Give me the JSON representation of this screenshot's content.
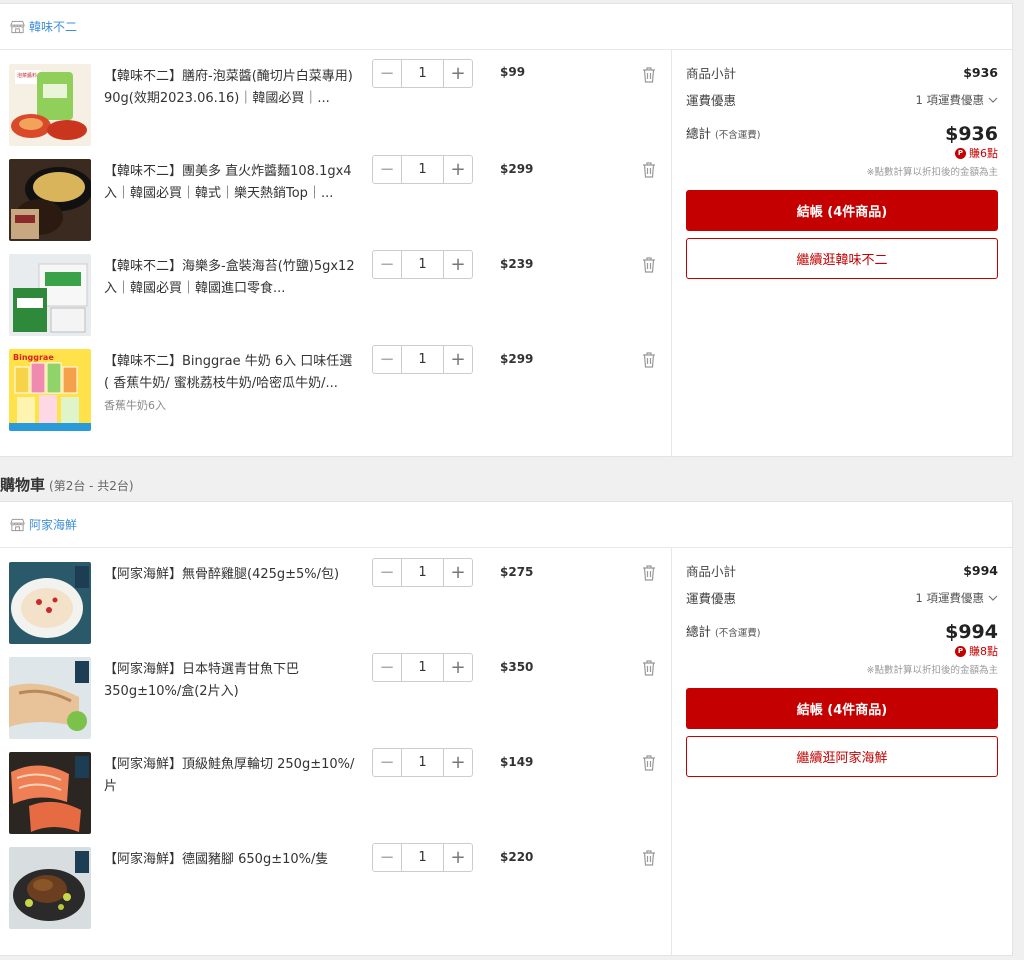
{
  "carts": [
    {
      "store": "韓味不二",
      "items": [
        {
          "name": "【韓味不二】膳府-泡菜醬(醃切片白菜專用) 90g(效期2023.06.16)｜韓國必買｜...",
          "spec": "",
          "qty": "1",
          "price": "$99",
          "image": "kimchi-sauce-image"
        },
        {
          "name": "【韓味不二】團美多 直火炸醬麵108.1gx4入｜韓國必買｜韓式｜樂天熱銷Top｜...",
          "spec": "",
          "qty": "1",
          "price": "$299",
          "image": "black-bean-noodle-image"
        },
        {
          "name": "【韓味不二】海樂多-盒裝海苔(竹鹽)5gx12入｜韓國必買｜韓國進口零食...",
          "spec": "",
          "qty": "1",
          "price": "$239",
          "image": "seaweed-image"
        },
        {
          "name": "【韓味不二】Binggrae 牛奶 6入 口味任選( 香蕉牛奶/ 蜜桃荔枝牛奶/哈密瓜牛奶/...",
          "spec": "香蕉牛奶6入",
          "qty": "1",
          "price": "$299",
          "image": "milk-image"
        }
      ],
      "summary": {
        "subtotal_label": "商品小計",
        "subtotal": "$936",
        "shipping_label": "運費優惠",
        "shipping_value": "1 項運費優惠",
        "total_label": "總計",
        "total_note": "(不含運費)",
        "total": "$936",
        "points": "賺6點",
        "points_note": "※點數計算以折扣後的金額為主",
        "checkout": "結帳 (4件商品)",
        "continue": "繼續逛韓味不二"
      }
    },
    {
      "store": "阿家海鮮",
      "items": [
        {
          "name": "【阿家海鮮】無骨醉雞腿(425g±5%/包)",
          "spec": "",
          "qty": "1",
          "price": "$275",
          "image": "drunken-chicken-image"
        },
        {
          "name": "【阿家海鮮】日本特選青甘魚下巴350g±10%/盒(2片入)",
          "spec": "",
          "qty": "1",
          "price": "$350",
          "image": "fish-collar-image"
        },
        {
          "name": "【阿家海鮮】頂級鮭魚厚輪切 250g±10%/片",
          "spec": "",
          "qty": "1",
          "price": "$149",
          "image": "salmon-image"
        },
        {
          "name": "【阿家海鮮】德國豬腳 650g±10%/隻",
          "spec": "",
          "qty": "1",
          "price": "$220",
          "image": "pork-knuckle-image"
        }
      ],
      "summary": {
        "subtotal_label": "商品小計",
        "subtotal": "$994",
        "shipping_label": "運費優惠",
        "shipping_value": "1 項運費優惠",
        "total_label": "總計",
        "total_note": "(不含運費)",
        "total": "$994",
        "points": "賺8點",
        "points_note": "※點數計算以折扣後的金額為主",
        "checkout": "結帳 (4件商品)",
        "continue": "繼續逛阿家海鮮"
      }
    }
  ],
  "section": {
    "title": "購物車",
    "sub": "(第2台 - 共2台)"
  },
  "colors": {
    "accent": "#c40000",
    "link": "#3e8fd8"
  }
}
